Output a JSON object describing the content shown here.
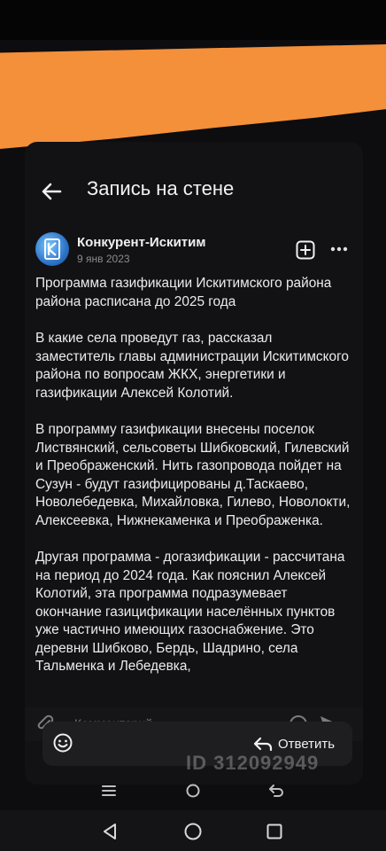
{
  "header": {
    "title": "Запись на стене"
  },
  "post": {
    "author": "Конкурент-Искитим",
    "date": "9 янв 2023",
    "paragraphs": [
      "Программа газификации Искитимского района района расписана до 2025 года",
      "В какие села проведут газ, рассказал заместитель главы администрации Искитимского района по вопросам ЖКХ, энергетики и газификации Алексей Колотий.",
      "В программу газификации внесены поселок Листвянский, сельсоветы Шибковский, Гилевский и Преображенский. Нить газопровода пойдет на Сузун - будут газифицированы д.Таскаево, Новолебедевка, Михайловка, Гилево, Новолокти, Алексеевка, Нижнекаменка и Преображенка.",
      "Другая программа - догазификации - рассчитана на период до 2024 года. Как пояснил Алексей Колотий, эта программа подразумевает окончание газицификации населённых пунктов уже частично имеющих газоснабжение. Это деревни Шибково, Бердь, Шадрино, села Тальменка и Лебедевка,"
    ]
  },
  "comment": {
    "placeholder": "Комментарий"
  },
  "reply": {
    "label": "Ответить"
  },
  "watermark": {
    "text": "ID 312092949"
  },
  "icons": {
    "back": "arrow-left-icon",
    "add": "add-square-icon",
    "more": "more-horizontal-icon",
    "attach": "paperclip-icon",
    "emoji": "emoji-icon",
    "send": "send-icon",
    "reply": "reply-arrow-icon",
    "menu": "menu-icon",
    "home": "home-icon",
    "return": "return-icon",
    "sys_back": "triangle-back-icon",
    "sys_home": "circle-home-icon",
    "sys_recents": "square-recents-icon"
  },
  "colors": {
    "accent_overlay": "#f48f3a",
    "background": "#0d0d0f"
  }
}
